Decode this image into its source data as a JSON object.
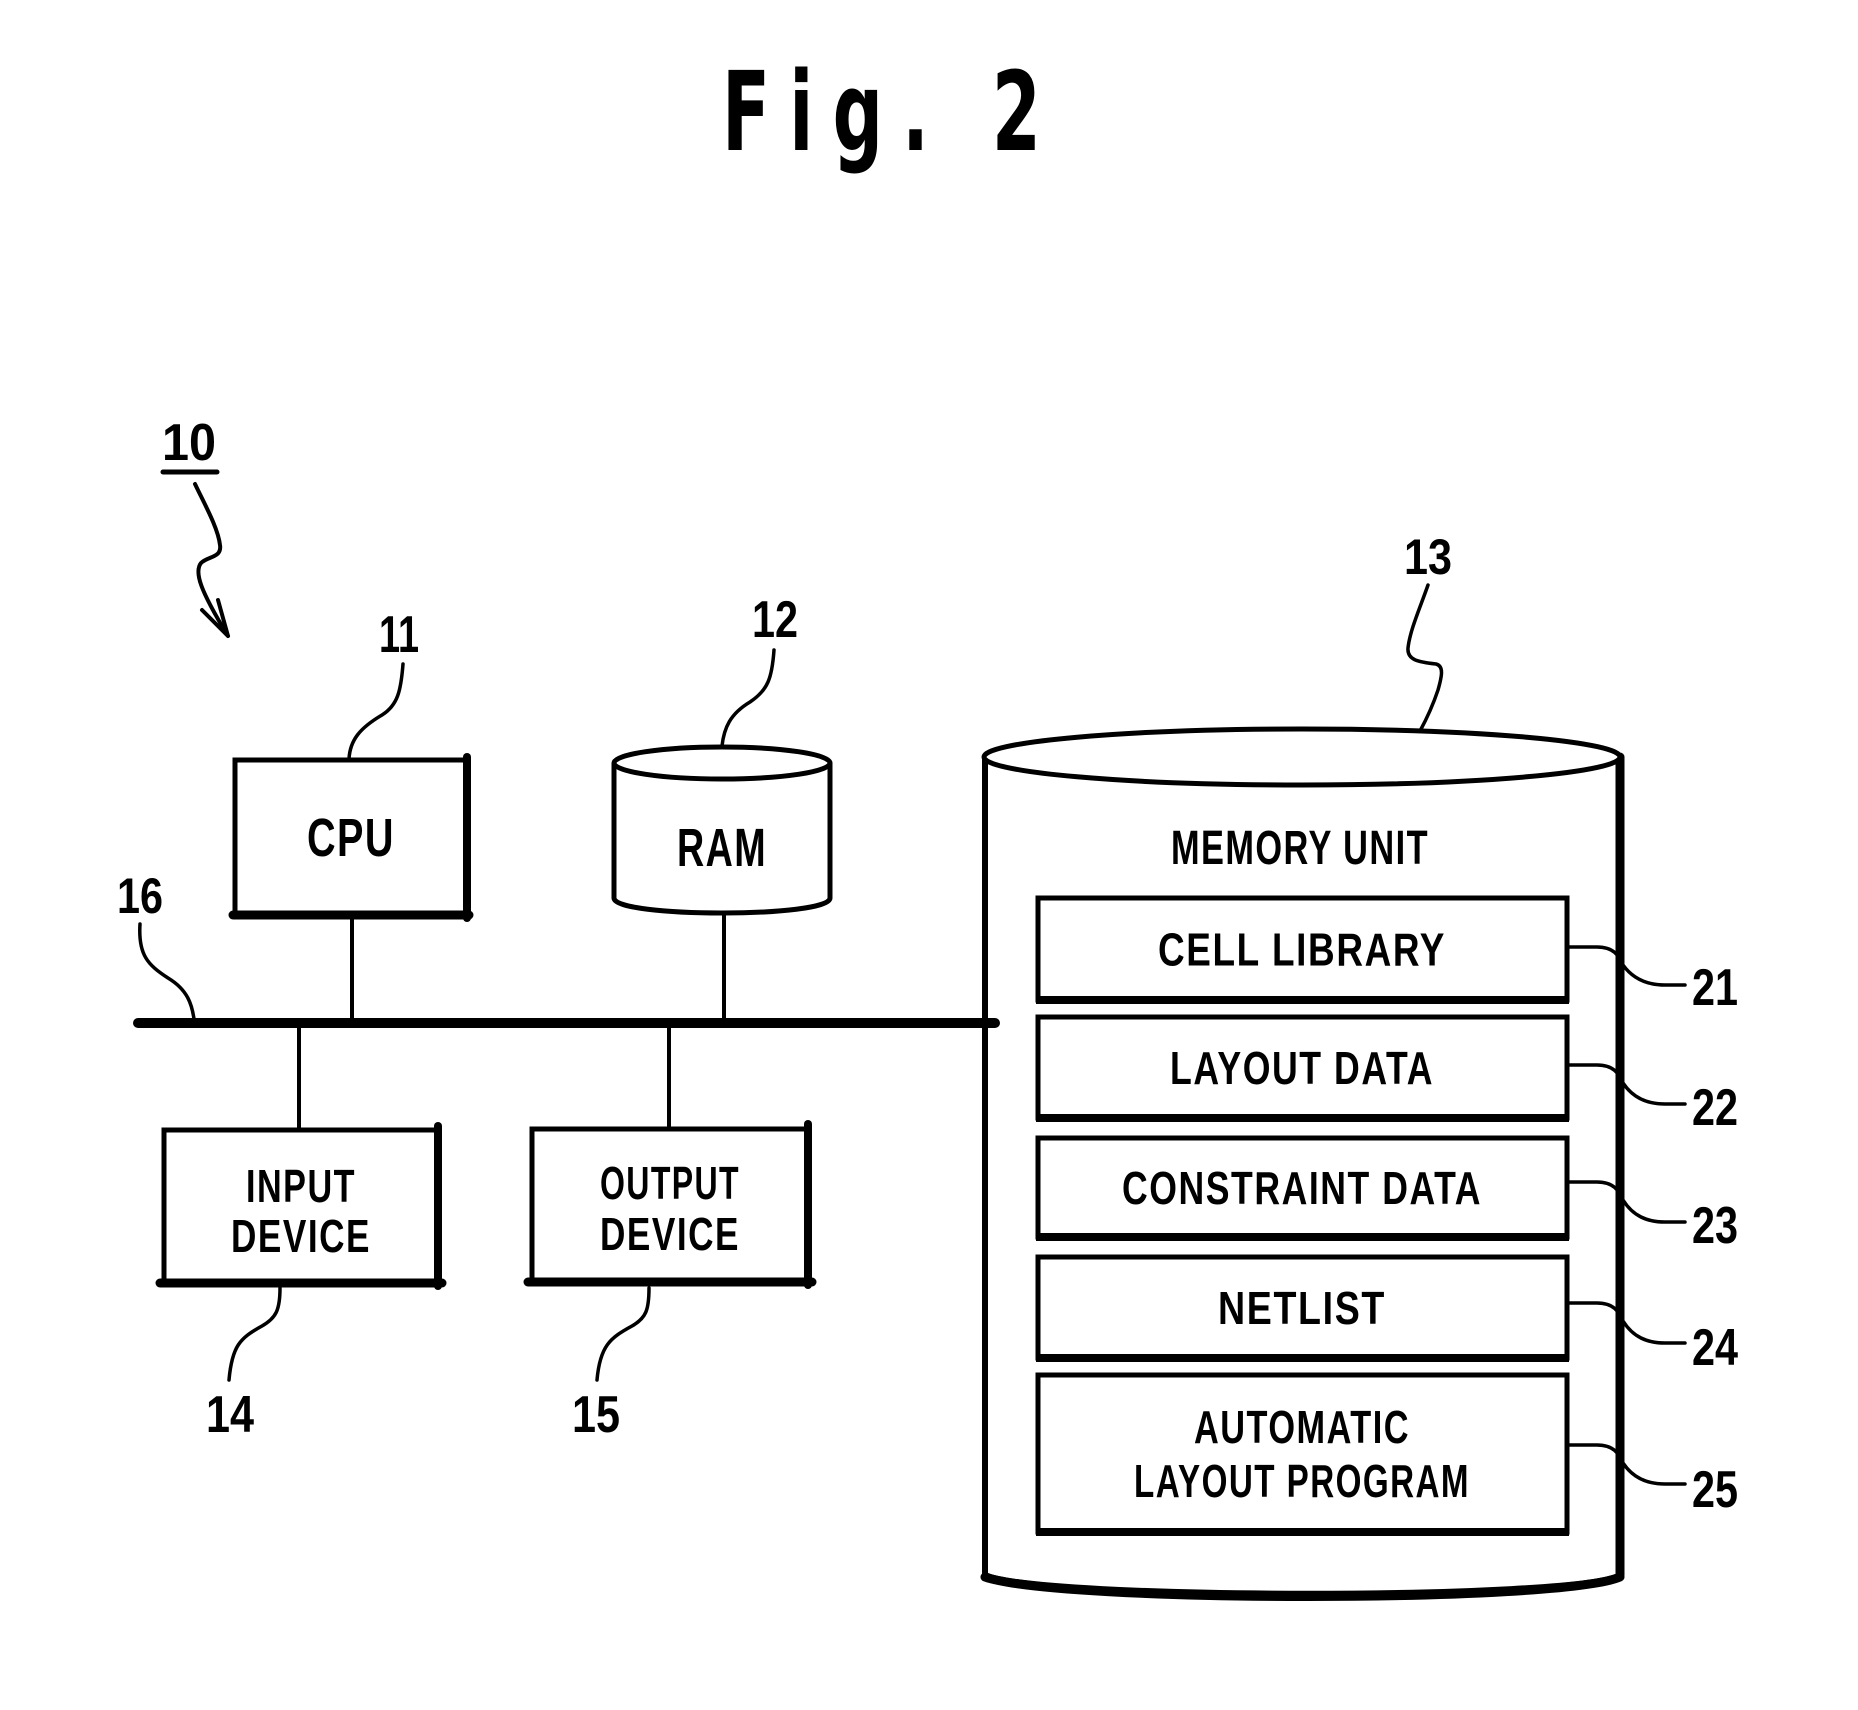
{
  "figure": {
    "title": "Fig. 2",
    "system_ref": "10"
  },
  "components": {
    "cpu": {
      "label": "CPU",
      "ref": "11"
    },
    "ram": {
      "label": "RAM",
      "ref": "12"
    },
    "memory_unit": {
      "label": "MEMORY UNIT",
      "ref": "13"
    },
    "input_device": {
      "label_lines": [
        "INPUT",
        "DEVICE"
      ],
      "ref": "14"
    },
    "output_device": {
      "label_lines": [
        "OUTPUT",
        "DEVICE"
      ],
      "ref": "15"
    },
    "bus": {
      "ref": "16"
    }
  },
  "memory_contents": [
    {
      "label_lines": [
        "CELL LIBRARY"
      ],
      "ref": "21"
    },
    {
      "label_lines": [
        "LAYOUT DATA"
      ],
      "ref": "22"
    },
    {
      "label_lines": [
        "CONSTRAINT DATA"
      ],
      "ref": "23"
    },
    {
      "label_lines": [
        "NETLIST"
      ],
      "ref": "24"
    },
    {
      "label_lines": [
        "AUTOMATIC",
        "LAYOUT PROGRAM"
      ],
      "ref": "25"
    }
  ],
  "colors": {
    "ink": "#000000",
    "paper": "#ffffff"
  }
}
